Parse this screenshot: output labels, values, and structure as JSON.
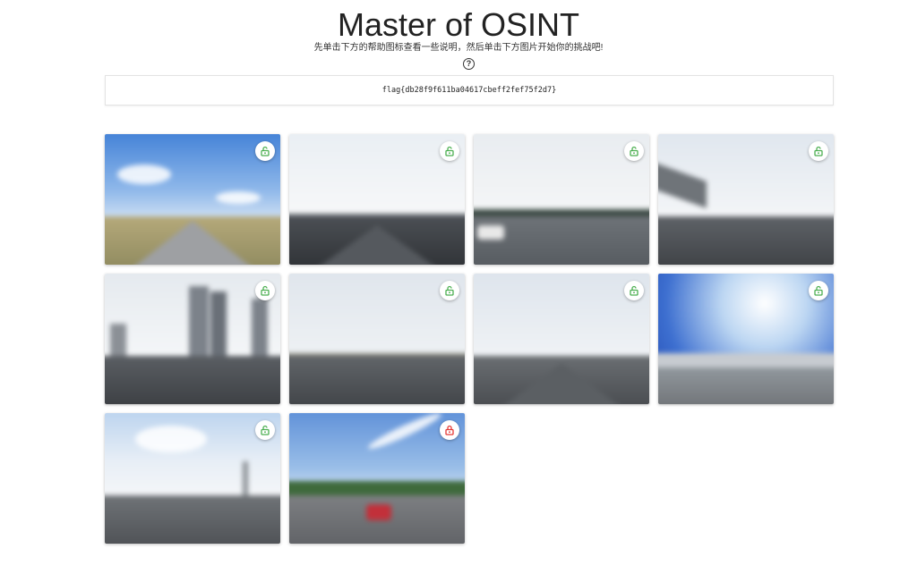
{
  "header": {
    "title": "Master of OSINT",
    "subtitle": "先单击下方的帮助图标查看一些说明，然后单击下方图片开始你的挑战吧!",
    "help_icon": "question-circle-icon"
  },
  "flag": {
    "value": "flag{db28f9f611ba04617cbeff2fef75f2d7}"
  },
  "colors": {
    "unlocked": "#4caf50",
    "locked": "#e53935"
  },
  "challenges": [
    {
      "status": "unlocked",
      "icon": "unlock-icon"
    },
    {
      "status": "unlocked",
      "icon": "unlock-icon"
    },
    {
      "status": "unlocked",
      "icon": "unlock-icon"
    },
    {
      "status": "unlocked",
      "icon": "unlock-icon"
    },
    {
      "status": "unlocked",
      "icon": "unlock-icon"
    },
    {
      "status": "unlocked",
      "icon": "unlock-icon"
    },
    {
      "status": "unlocked",
      "icon": "unlock-icon"
    },
    {
      "status": "unlocked",
      "icon": "unlock-icon"
    },
    {
      "status": "unlocked",
      "icon": "unlock-icon"
    },
    {
      "status": "locked",
      "icon": "lock-icon"
    }
  ]
}
